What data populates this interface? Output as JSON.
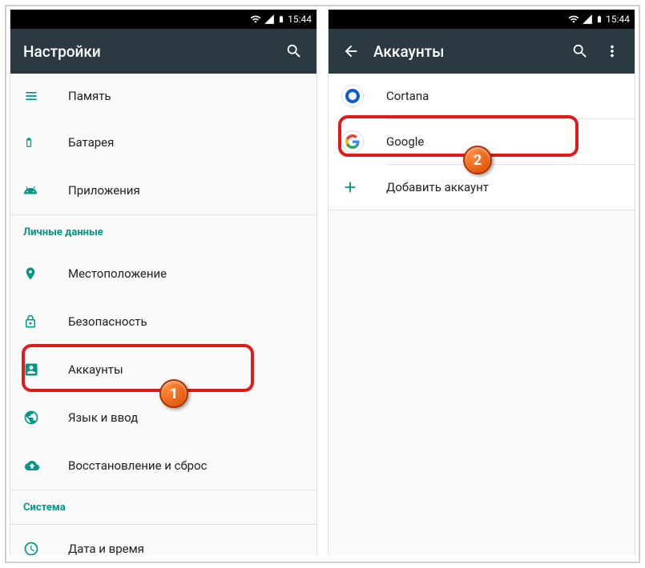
{
  "status": {
    "time": "15:44"
  },
  "left": {
    "title": "Настройки",
    "items": {
      "memory": "Память",
      "battery": "Батарея",
      "apps": "Приложения",
      "location": "Местоположение",
      "security": "Безопасность",
      "accounts": "Аккаунты",
      "language": "Язык и ввод",
      "backup": "Восстановление и сброс",
      "datetime": "Дата и время"
    },
    "sections": {
      "personal": "Личные данные",
      "system": "Система"
    }
  },
  "right": {
    "title": "Аккаунты",
    "items": {
      "cortana": "Cortana",
      "google": "Google",
      "add": "Добавить аккаунт"
    }
  },
  "callouts": {
    "one": "1",
    "two": "2"
  }
}
